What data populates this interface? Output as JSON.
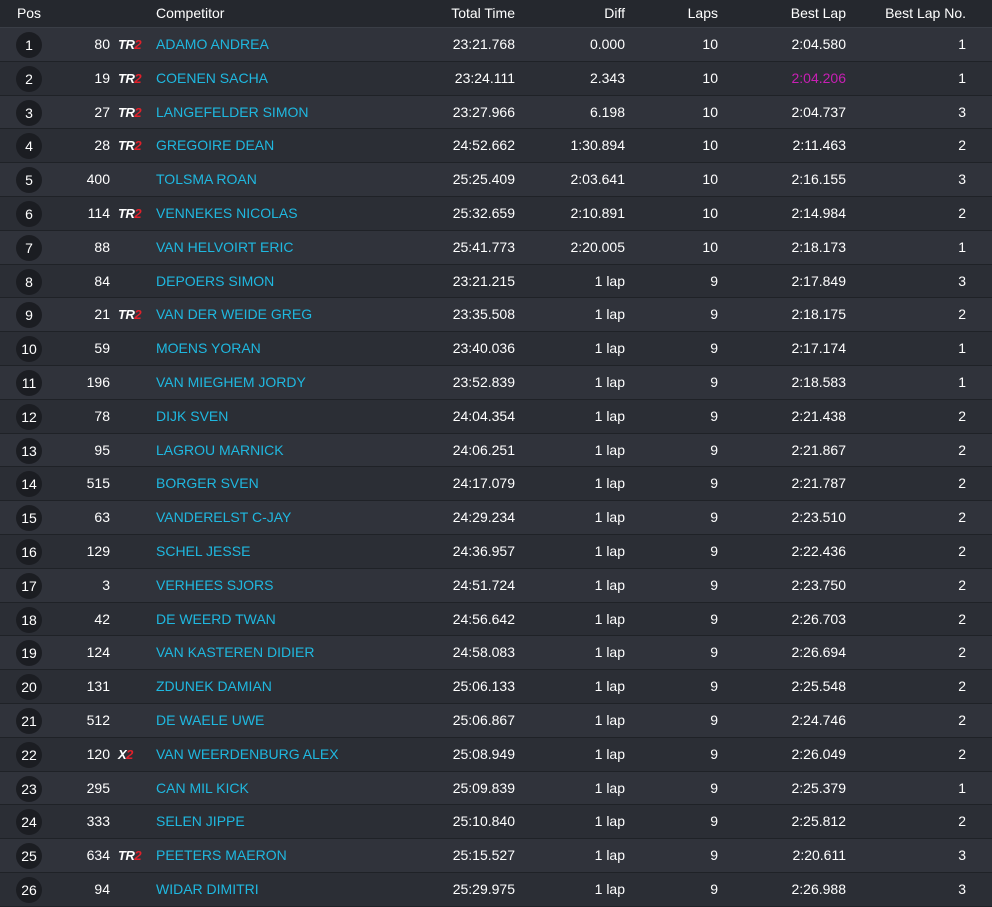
{
  "table": {
    "headers": {
      "pos": "Pos",
      "competitor": "Competitor",
      "total_time": "Total Time",
      "diff": "Diff",
      "laps": "Laps",
      "best_lap": "Best Lap",
      "best_lap_no": "Best Lap No."
    },
    "colors": {
      "competitor_link": "#1fb8e0",
      "fastest_lap": "#c81fb4",
      "badge_red": "#e0202a"
    },
    "rows": [
      {
        "pos": "1",
        "num": "80",
        "badge_prefix": "TR",
        "badge_suffix": "2",
        "name": "ADAMO ANDREA",
        "total": "23:21.768",
        "diff": "0.000",
        "laps": "10",
        "best": "2:04.580",
        "best_no": "1",
        "fastest": false
      },
      {
        "pos": "2",
        "num": "19",
        "badge_prefix": "TR",
        "badge_suffix": "2",
        "name": "COENEN SACHA",
        "total": "23:24.111",
        "diff": "2.343",
        "laps": "10",
        "best": "2:04.206",
        "best_no": "1",
        "fastest": true
      },
      {
        "pos": "3",
        "num": "27",
        "badge_prefix": "TR",
        "badge_suffix": "2",
        "name": "LANGEFELDER SIMON",
        "total": "23:27.966",
        "diff": "6.198",
        "laps": "10",
        "best": "2:04.737",
        "best_no": "3",
        "fastest": false
      },
      {
        "pos": "4",
        "num": "28",
        "badge_prefix": "TR",
        "badge_suffix": "2",
        "name": "GREGOIRE DEAN",
        "total": "24:52.662",
        "diff": "1:30.894",
        "laps": "10",
        "best": "2:11.463",
        "best_no": "2",
        "fastest": false
      },
      {
        "pos": "5",
        "num": "400",
        "badge_prefix": "",
        "badge_suffix": "",
        "name": "TOLSMA ROAN",
        "total": "25:25.409",
        "diff": "2:03.641",
        "laps": "10",
        "best": "2:16.155",
        "best_no": "3",
        "fastest": false
      },
      {
        "pos": "6",
        "num": "114",
        "badge_prefix": "TR",
        "badge_suffix": "2",
        "name": "VENNEKES NICOLAS",
        "total": "25:32.659",
        "diff": "2:10.891",
        "laps": "10",
        "best": "2:14.984",
        "best_no": "2",
        "fastest": false
      },
      {
        "pos": "7",
        "num": "88",
        "badge_prefix": "",
        "badge_suffix": "",
        "name": "VAN HELVOIRT ERIC",
        "total": "25:41.773",
        "diff": "2:20.005",
        "laps": "10",
        "best": "2:18.173",
        "best_no": "1",
        "fastest": false
      },
      {
        "pos": "8",
        "num": "84",
        "badge_prefix": "",
        "badge_suffix": "",
        "name": "DEPOERS SIMON",
        "total": "23:21.215",
        "diff": "1 lap",
        "laps": "9",
        "best": "2:17.849",
        "best_no": "3",
        "fastest": false
      },
      {
        "pos": "9",
        "num": "21",
        "badge_prefix": "TR",
        "badge_suffix": "2",
        "name": "VAN DER WEIDE GREG",
        "total": "23:35.508",
        "diff": "1 lap",
        "laps": "9",
        "best": "2:18.175",
        "best_no": "2",
        "fastest": false
      },
      {
        "pos": "10",
        "num": "59",
        "badge_prefix": "",
        "badge_suffix": "",
        "name": "MOENS YORAN",
        "total": "23:40.036",
        "diff": "1 lap",
        "laps": "9",
        "best": "2:17.174",
        "best_no": "1",
        "fastest": false
      },
      {
        "pos": "11",
        "num": "196",
        "badge_prefix": "",
        "badge_suffix": "",
        "name": "VAN MIEGHEM JORDY",
        "total": "23:52.839",
        "diff": "1 lap",
        "laps": "9",
        "best": "2:18.583",
        "best_no": "1",
        "fastest": false
      },
      {
        "pos": "12",
        "num": "78",
        "badge_prefix": "",
        "badge_suffix": "",
        "name": "DIJK SVEN",
        "total": "24:04.354",
        "diff": "1 lap",
        "laps": "9",
        "best": "2:21.438",
        "best_no": "2",
        "fastest": false
      },
      {
        "pos": "13",
        "num": "95",
        "badge_prefix": "",
        "badge_suffix": "",
        "name": "LAGROU MARNICK",
        "total": "24:06.251",
        "diff": "1 lap",
        "laps": "9",
        "best": "2:21.867",
        "best_no": "2",
        "fastest": false
      },
      {
        "pos": "14",
        "num": "515",
        "badge_prefix": "",
        "badge_suffix": "",
        "name": "BORGER SVEN",
        "total": "24:17.079",
        "diff": "1 lap",
        "laps": "9",
        "best": "2:21.787",
        "best_no": "2",
        "fastest": false
      },
      {
        "pos": "15",
        "num": "63",
        "badge_prefix": "",
        "badge_suffix": "",
        "name": "VANDERELST C-JAY",
        "total": "24:29.234",
        "diff": "1 lap",
        "laps": "9",
        "best": "2:23.510",
        "best_no": "2",
        "fastest": false
      },
      {
        "pos": "16",
        "num": "129",
        "badge_prefix": "",
        "badge_suffix": "",
        "name": "SCHEL JESSE",
        "total": "24:36.957",
        "diff": "1 lap",
        "laps": "9",
        "best": "2:22.436",
        "best_no": "2",
        "fastest": false
      },
      {
        "pos": "17",
        "num": "3",
        "badge_prefix": "",
        "badge_suffix": "",
        "name": "VERHEES SJORS",
        "total": "24:51.724",
        "diff": "1 lap",
        "laps": "9",
        "best": "2:23.750",
        "best_no": "2",
        "fastest": false
      },
      {
        "pos": "18",
        "num": "42",
        "badge_prefix": "",
        "badge_suffix": "",
        "name": "DE WEERD TWAN",
        "total": "24:56.642",
        "diff": "1 lap",
        "laps": "9",
        "best": "2:26.703",
        "best_no": "2",
        "fastest": false
      },
      {
        "pos": "19",
        "num": "124",
        "badge_prefix": "",
        "badge_suffix": "",
        "name": "VAN KASTEREN DIDIER",
        "total": "24:58.083",
        "diff": "1 lap",
        "laps": "9",
        "best": "2:26.694",
        "best_no": "2",
        "fastest": false
      },
      {
        "pos": "20",
        "num": "131",
        "badge_prefix": "",
        "badge_suffix": "",
        "name": "ZDUNEK DAMIAN",
        "total": "25:06.133",
        "diff": "1 lap",
        "laps": "9",
        "best": "2:25.548",
        "best_no": "2",
        "fastest": false
      },
      {
        "pos": "21",
        "num": "512",
        "badge_prefix": "",
        "badge_suffix": "",
        "name": "DE WAELE UWE",
        "total": "25:06.867",
        "diff": "1 lap",
        "laps": "9",
        "best": "2:24.746",
        "best_no": "2",
        "fastest": false
      },
      {
        "pos": "22",
        "num": "120",
        "badge_prefix": "X",
        "badge_suffix": "2",
        "name": "VAN WEERDENBURG ALEX",
        "total": "25:08.949",
        "diff": "1 lap",
        "laps": "9",
        "best": "2:26.049",
        "best_no": "2",
        "fastest": false
      },
      {
        "pos": "23",
        "num": "295",
        "badge_prefix": "",
        "badge_suffix": "",
        "name": "CAN MIL KICK",
        "total": "25:09.839",
        "diff": "1 lap",
        "laps": "9",
        "best": "2:25.379",
        "best_no": "1",
        "fastest": false
      },
      {
        "pos": "24",
        "num": "333",
        "badge_prefix": "",
        "badge_suffix": "",
        "name": "SELEN JIPPE",
        "total": "25:10.840",
        "diff": "1 lap",
        "laps": "9",
        "best": "2:25.812",
        "best_no": "2",
        "fastest": false
      },
      {
        "pos": "25",
        "num": "634",
        "badge_prefix": "TR",
        "badge_suffix": "2",
        "name": "PEETERS MAERON",
        "total": "25:15.527",
        "diff": "1 lap",
        "laps": "9",
        "best": "2:20.611",
        "best_no": "3",
        "fastest": false
      },
      {
        "pos": "26",
        "num": "94",
        "badge_prefix": "",
        "badge_suffix": "",
        "name": "WIDAR DIMITRI",
        "total": "25:29.975",
        "diff": "1 lap",
        "laps": "9",
        "best": "2:26.988",
        "best_no": "3",
        "fastest": false
      }
    ]
  }
}
